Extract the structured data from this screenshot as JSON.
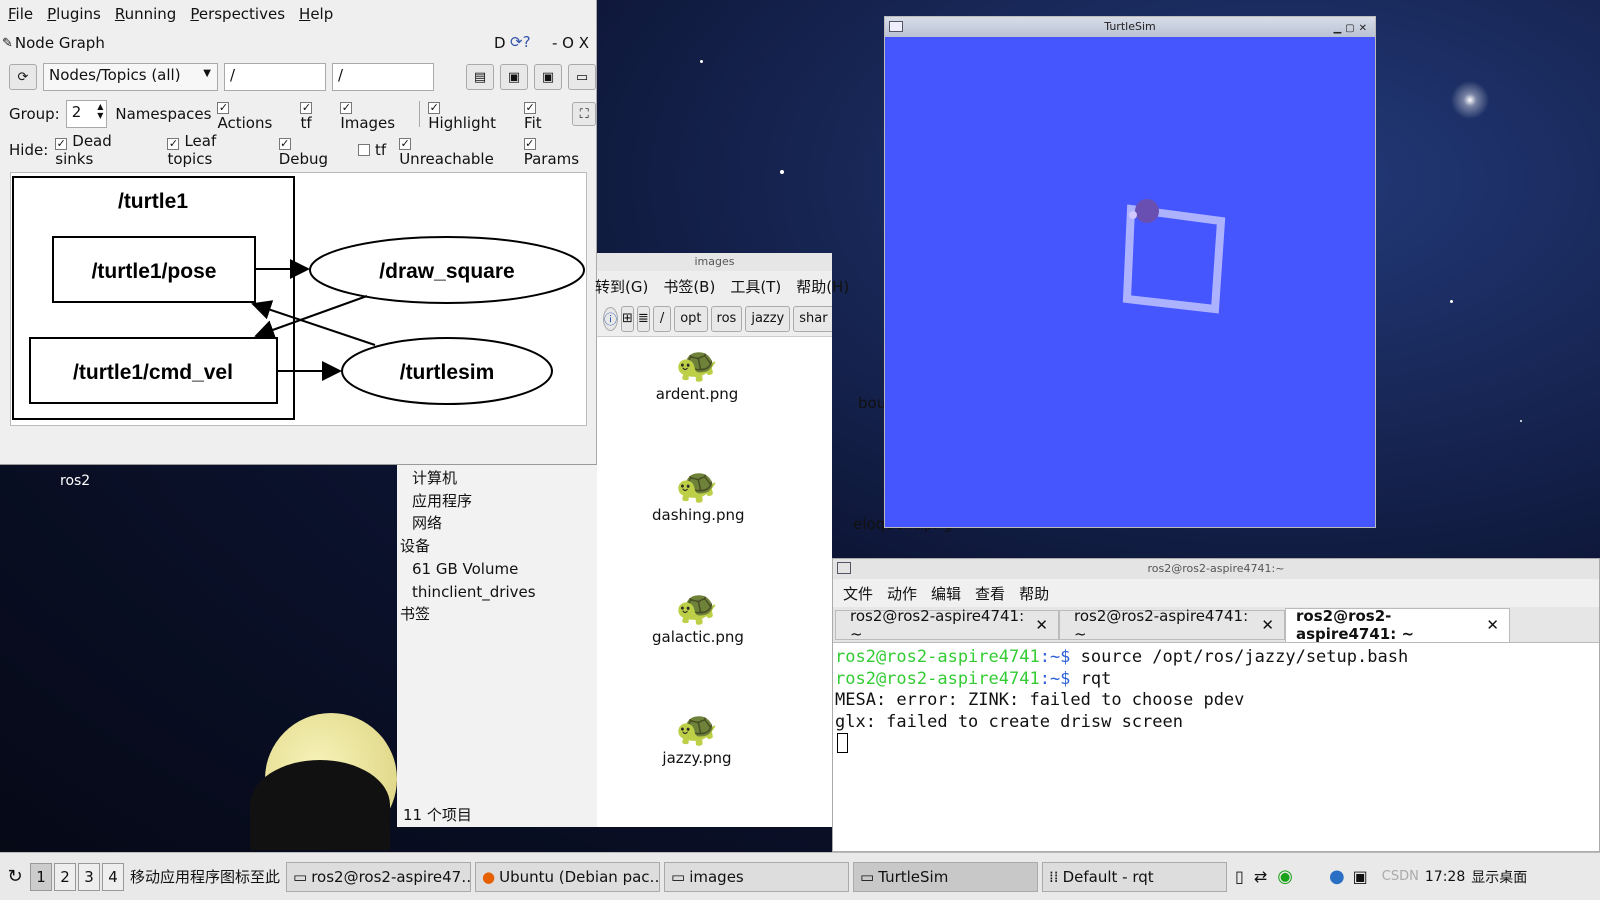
{
  "desktop": {
    "icon_label": "ros2"
  },
  "rqt": {
    "menu": [
      "File",
      "Plugins",
      "Running",
      "Perspectives",
      "Help"
    ],
    "plugin_title": "Node Graph",
    "title_controls": "D",
    "title_extra": "- O X",
    "filter_mode": "Nodes/Topics (all)",
    "ns_filter": "/",
    "topic_filter": "/",
    "group_label": "Group:",
    "group_value": "2",
    "row2": [
      "Namespaces",
      "Actions",
      "tf",
      "Images",
      "Highlight",
      "Fit"
    ],
    "hide_label": "Hide:",
    "hide_items": [
      {
        "label": "Dead sinks",
        "checked": true
      },
      {
        "label": "Leaf topics",
        "checked": true
      },
      {
        "label": "Debug",
        "checked": true
      },
      {
        "label": "tf",
        "checked": false
      },
      {
        "label": "Unreachable",
        "checked": true
      },
      {
        "label": "Params",
        "checked": true
      }
    ],
    "graph": {
      "cluster": "/turtle1",
      "pose": "/turtle1/pose",
      "cmd_vel": "/turtle1/cmd_vel",
      "draw_square": "/draw_square",
      "turtlesim": "/turtlesim"
    }
  },
  "filemanager": {
    "title": "images",
    "menu": [
      "转到(G)",
      "书签(B)",
      "工具(T)",
      "帮助(H)"
    ],
    "path": [
      "/",
      "opt",
      "ros",
      "jazzy",
      "shar"
    ],
    "sidebar": [
      "计算机",
      "应用程序",
      "网络",
      "设备",
      "61 GB Volume",
      "thinclient_drives",
      "书签"
    ],
    "files": [
      "ardent.png",
      "dashing.png",
      "galactic.png",
      "jazzy.png"
    ],
    "files_right": [
      "bou",
      "eloquent.png"
    ],
    "status": "11 个项目"
  },
  "turtlesim": {
    "title": "TurtleSim",
    "bg": "#4556ff"
  },
  "terminal": {
    "title": "ros2@ros2-aspire4741:~",
    "menu": [
      "文件",
      "动作",
      "编辑",
      "查看",
      "帮助"
    ],
    "tabs": [
      "ros2@ros2-aspire4741: ~",
      "ros2@ros2-aspire4741: ~",
      "ros2@ros2-aspire4741: ~"
    ],
    "prompt_user": "ros2@ros2-aspire4741",
    "prompt_tail": ":~$",
    "cmd1": " source /opt/ros/jazzy/setup.bash",
    "cmd2": " rqt",
    "out1": "MESA: error: ZINK: failed to choose pdev",
    "out2": "glx: failed to create drisw screen"
  },
  "taskbar": {
    "workspaces": [
      "1",
      "2",
      "3",
      "4"
    ],
    "hint": "移动应用程序图标至此",
    "tasks": [
      "ros2@ros2-aspire47…",
      "Ubuntu (Debian pac…",
      "images",
      "TurtleSim",
      "Default - rqt"
    ],
    "clock": "17:28",
    "watermark": "CSDN",
    "show_desktop": "显示桌面"
  }
}
